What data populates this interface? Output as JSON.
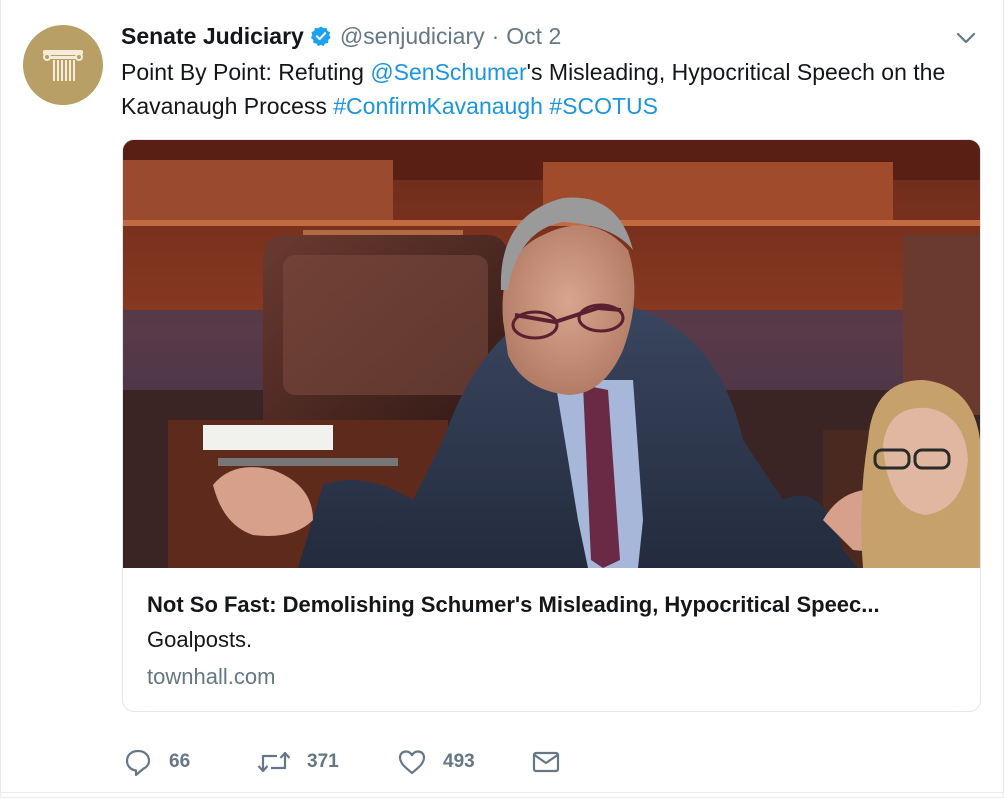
{
  "tweet": {
    "author_name": "Senate Judiciary",
    "author_handle": "@senjudiciary",
    "separator": "·",
    "date": "Oct 2",
    "text_part1": "Point By Point: Refuting ",
    "mention": "@SenSchumer",
    "text_part2": "'s Misleading, Hypocritical Speech on the Kavanaugh Process ",
    "hashtag1": "#ConfirmKavanaugh",
    "text_space": " ",
    "hashtag2": "#SCOTUS"
  },
  "card": {
    "title": "Not So Fast: Demolishing Schumer's Misleading, Hypocritical Speec...",
    "description": "Goalposts.",
    "domain": "townhall.com"
  },
  "actions": {
    "reply_count": "66",
    "retweet_count": "371",
    "like_count": "493"
  },
  "icons": {
    "avatar": "pillar-icon",
    "verified": "verified-badge-icon",
    "menu": "chevron-down-icon",
    "reply": "reply-icon",
    "retweet": "retweet-icon",
    "like": "heart-icon",
    "message": "envelope-icon"
  },
  "colors": {
    "link": "#1b95e0",
    "secondary_text": "#657786",
    "avatar_bg": "#b89f66",
    "border": "#e1e8ed"
  }
}
